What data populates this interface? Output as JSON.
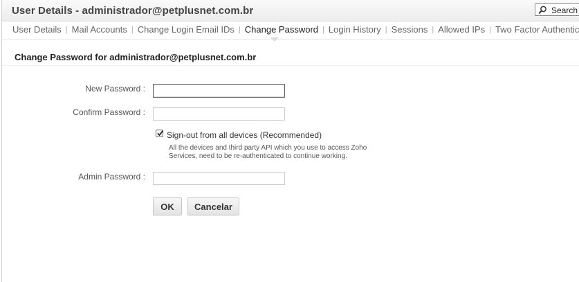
{
  "header": {
    "title": "User Details - administrador@petplusnet.com.br",
    "search_label": "Search U"
  },
  "tabs": [
    {
      "label": "User Details"
    },
    {
      "label": "Mail Accounts"
    },
    {
      "label": "Change Login Email IDs"
    },
    {
      "label": "Change Password",
      "active": true
    },
    {
      "label": "Login History"
    },
    {
      "label": "Sessions"
    },
    {
      "label": "Allowed IPs"
    },
    {
      "label": "Two Factor Authentication"
    }
  ],
  "tab_separator": "|",
  "form": {
    "title": "Change Password for administrador@petplusnet.com.br",
    "new_password_label": "New Password :",
    "new_password_value": "",
    "confirm_password_label": "Confirm Password :",
    "confirm_password_value": "",
    "signout_checkbox_label": "Sign-out from all devices (Recommended)",
    "signout_checked": true,
    "signout_note": "All the devices and third party API which you use to access Zoho Services, need to be re-authenticated to continue working.",
    "admin_password_label": "Admin Password :",
    "admin_password_value": "",
    "ok_label": "OK",
    "cancel_label": "Cancelar"
  },
  "colors": {
    "header_bg": "#ececec",
    "text": "#333333",
    "tab_inactive": "#666666"
  }
}
